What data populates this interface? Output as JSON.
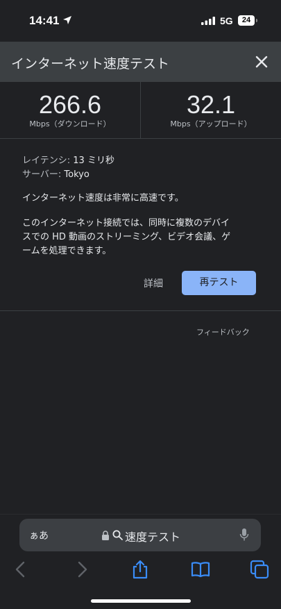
{
  "status_bar": {
    "time": "14:41",
    "network": "5G",
    "battery": "24"
  },
  "header": {
    "title": "インターネット速度テスト",
    "close_icon": "close-icon"
  },
  "speed": {
    "download_value": "266.6",
    "download_unit": "Mbps（ダウンロード）",
    "upload_value": "32.1",
    "upload_unit": "Mbps（アップロード）"
  },
  "details": {
    "latency_label": "レイテンシ:",
    "latency_value": "13 ミリ秒",
    "server_label": "サーバー:",
    "server_value": "Tokyo",
    "summary": "インターネット速度は非常に高速です。",
    "description_line1": "このインターネット接続では、同時に複数のデバイ",
    "description_line2": "スでの HD 動画のストリーミング、ビデオ会議、ゲ",
    "description_line3": "ームを処理できます。"
  },
  "actions": {
    "details_label": "詳細",
    "retest_label": "再テスト",
    "feedback_label": "フィードバック"
  },
  "browser": {
    "aa_label": "ぁあ",
    "url_text": "速度テスト",
    "icons": [
      "lock-icon",
      "search-icon",
      "mic-icon",
      "back-icon",
      "forward-icon",
      "share-icon",
      "bookmarks-icon",
      "tabs-icon"
    ]
  },
  "colors": {
    "background": "#202124",
    "header": "#3c4043",
    "accent": "#8ab4f8",
    "ios_blue": "#3a8cf7"
  }
}
